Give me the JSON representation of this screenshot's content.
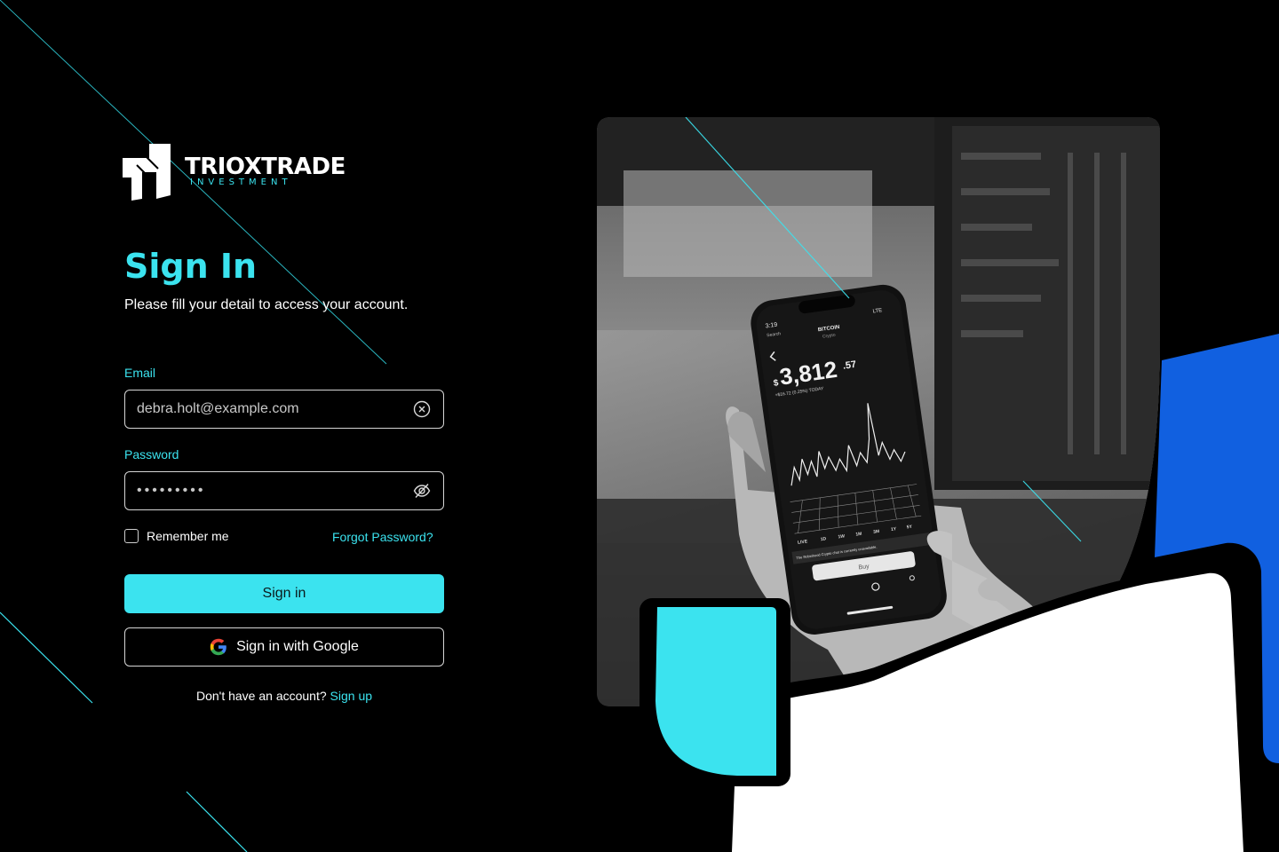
{
  "brand": {
    "name": "TRIOXTRADE",
    "tagline": "INVESTMENT"
  },
  "header": {
    "title": "Sign In",
    "subtitle": "Please fill your detail to access your account."
  },
  "form": {
    "email_label": "Email",
    "email_value": "debra.holt@example.com",
    "password_label": "Password",
    "password_value": "•••••••••",
    "remember_label": "Remember me",
    "remember_checked": false,
    "forgot_label": "Forgot Password?",
    "signin_label": "Sign in",
    "google_label": "Sign in with Google",
    "no_account_text": "Don't have an account?",
    "signup_label": "Sign up"
  },
  "phone": {
    "time": "3:19",
    "back_label": "Search",
    "network": "LTE",
    "asset_name": "BITCOIN",
    "asset_type": "Crypto",
    "price_symbol": "$",
    "price_main": "3,812",
    "price_cents": ".57",
    "change_text": "+$16.72 (0.25%) TODAY",
    "ranges": [
      "LIVE",
      "1D",
      "1W",
      "1M",
      "3M",
      "1Y",
      "5Y"
    ],
    "notice": "The Robinhood Crypto chat is currently unavailable.",
    "buy_label": "Buy"
  },
  "icons": {
    "logo": "trioxtrade-logo-icon",
    "clear": "clear-circle-icon",
    "visibility": "eye-off-icon",
    "google": "google-icon"
  },
  "colors": {
    "accent": "#3be3ef",
    "background": "#000000",
    "blue": "#1160e0",
    "white": "#ffffff"
  }
}
